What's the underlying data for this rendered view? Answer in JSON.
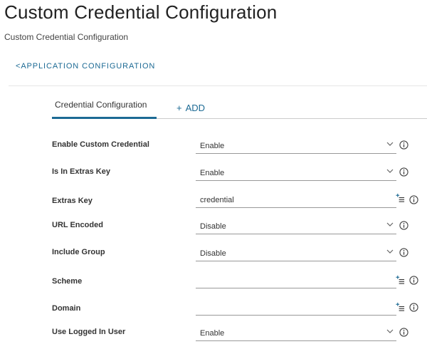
{
  "page": {
    "title": "Custom Credential Configuration",
    "subtitle": "Custom Credential Configuration",
    "back_link": "<APPLICATION CONFIGURATION"
  },
  "tabs": {
    "active_label": "Credential Configuration",
    "add_plus": "+",
    "add_label": "ADD"
  },
  "form": {
    "fields": [
      {
        "label": "Enable Custom Credential",
        "value": "Enable"
      },
      {
        "label": "Is In Extras Key",
        "value": "Enable"
      },
      {
        "label": "Extras Key",
        "value": "credential"
      },
      {
        "label": "URL Encoded",
        "value": "Disable"
      },
      {
        "label": "Include Group",
        "value": "Disable"
      },
      {
        "label": "Scheme",
        "value": ""
      },
      {
        "label": "Domain",
        "value": ""
      },
      {
        "label": "Use Logged In User",
        "value": "Enable"
      }
    ]
  },
  "colors": {
    "accent": "#1c6a94",
    "text": "#333333",
    "divider": "#cccccc"
  }
}
